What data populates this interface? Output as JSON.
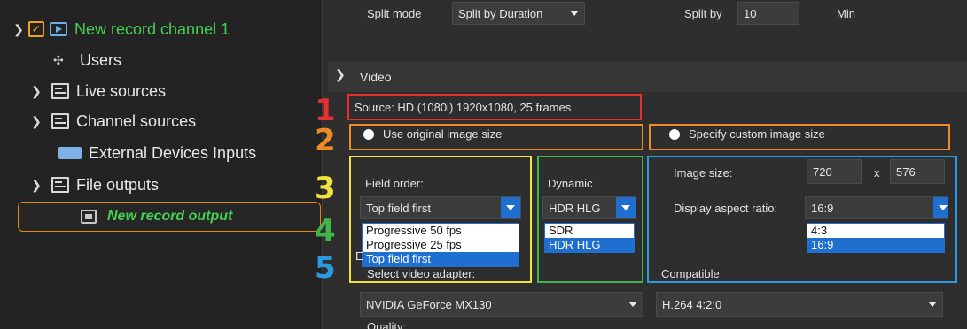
{
  "tree": {
    "channel_label": "New record channel 1",
    "users_label": "Users",
    "live_sources_label": "Live sources",
    "channel_sources_label": "Channel sources",
    "external_devices_label": "External Devices Inputs",
    "file_outputs_label": "File outputs",
    "record_output_label": "New record output"
  },
  "top_bar": {
    "split_mode_label": "Split mode",
    "split_mode_value": "Split by Duration",
    "split_by_label": "Split by",
    "split_by_value": "10",
    "split_unit": "Min"
  },
  "video": {
    "section_title": "Video",
    "source_text": "Source: HD (1080i) 1920x1080, 25 frames",
    "use_original_label": "Use original image size",
    "specify_custom_label": "Specify custom image size",
    "field_order": {
      "label": "Field order:",
      "value": "Top field first",
      "options": [
        "Progressive 50 fps",
        "Progressive 25 fps",
        "Top field first"
      ],
      "selected_index": 2
    },
    "dynamic": {
      "label": "Dynamic",
      "value": "HDR HLG",
      "options": [
        "SDR",
        "HDR HLG"
      ],
      "selected_index": 1
    },
    "image_size": {
      "label": "Image size:",
      "width": "720",
      "separator": "x",
      "height": "576"
    },
    "aspect_ratio": {
      "label": "Display aspect ratio:",
      "value": "16:9",
      "options": [
        "4:3",
        "16:9"
      ],
      "selected_index": 1
    }
  },
  "encoder": {
    "section_letter": "E",
    "adapter_label": "Select video adapter:",
    "adapter_value": "NVIDIA GeForce MX130",
    "compatible_label": "Compatible",
    "compatible_value": "H.264 4:2:0",
    "quality_label": "Quality:"
  },
  "annotations": {
    "numbers": [
      "1",
      "2",
      "3",
      "4",
      "5"
    ],
    "colors": {
      "1": "#e53030",
      "2": "#f08a24",
      "3": "#f2e33a",
      "4": "#3fb54a",
      "5": "#2a9be0"
    }
  }
}
